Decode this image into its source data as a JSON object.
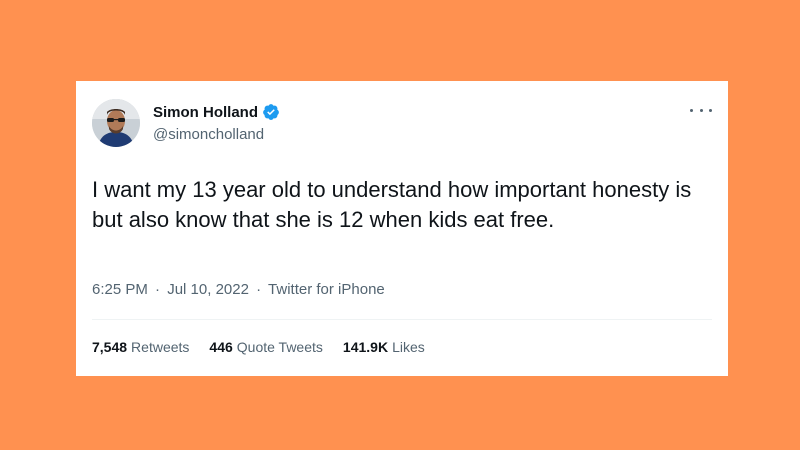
{
  "colors": {
    "background": "#ff9150",
    "card": "#ffffff",
    "text_primary": "#0f1419",
    "text_secondary": "#536471",
    "verified_badge": "#1d9bf0"
  },
  "author": {
    "display_name": "Simon Holland",
    "handle": "@simoncholland",
    "verified": true
  },
  "tweet": {
    "text": "I want my 13 year old to understand how important honesty is but also know that she is 12 when kids eat free."
  },
  "meta": {
    "time": "6:25 PM",
    "separator": "·",
    "date": "Jul 10, 2022",
    "source": "Twitter for iPhone"
  },
  "stats": {
    "retweets_count": "7,548",
    "retweets_label": "Retweets",
    "quotes_count": "446",
    "quotes_label": "Quote Tweets",
    "likes_count": "141.9K",
    "likes_label": "Likes"
  },
  "icons": {
    "avatar": "avatar-photo",
    "verified": "verified-badge-icon",
    "more": "more-options-icon"
  }
}
